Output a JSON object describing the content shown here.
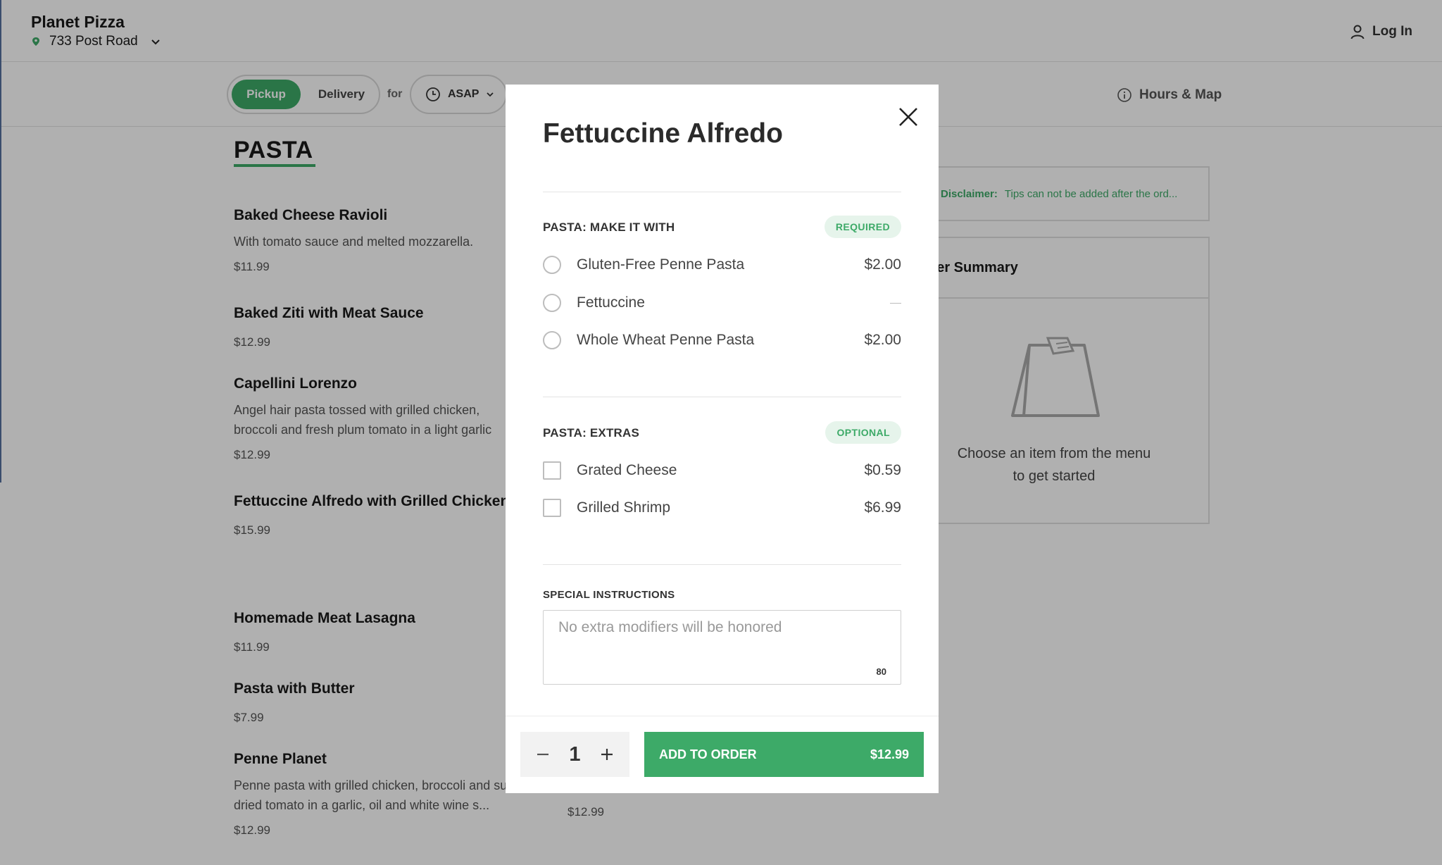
{
  "header": {
    "restaurant_name": "Planet Pizza",
    "location": "733 Post Road",
    "login_label": "Log In"
  },
  "order_bar": {
    "pickup_label": "Pickup",
    "delivery_label": "Delivery",
    "for_label": "for",
    "time_label": "ASAP",
    "hours_map_label": "Hours & Map"
  },
  "menu": {
    "section_title": "PASTA",
    "items": [
      {
        "name": "Baked Cheese Ravioli",
        "desc": "With tomato sauce and melted mozzarella.",
        "price": "$11.99"
      },
      {
        "name": "Baked Ziti with Meat Sauce",
        "desc": "",
        "price": "$12.99"
      },
      {
        "name": "Capellini Lorenzo",
        "desc": "Angel hair pasta tossed with grilled chicken, broccoli and fresh plum tomato in a light garlic",
        "price": "$12.99"
      },
      {
        "name": "Fettuccine Alfredo with Grilled Chicken",
        "desc": "",
        "price": "$15.99"
      },
      {
        "name": "Homemade Meat Lasagna",
        "desc": "",
        "price": "$11.99"
      },
      {
        "name": "Pasta with Butter",
        "desc": "",
        "price": "$7.99"
      },
      {
        "name": "Penne Planet",
        "desc": "Penne pasta with grilled chicken, broccoli and sun-dried tomato in a garlic, oil and white wine s...",
        "price": "$12.99"
      }
    ],
    "right_column_price": "$12.99"
  },
  "sidebar": {
    "disclaimer_label": "Disclaimer:",
    "disclaimer_text": "Tips can not be added after the ord...",
    "summary_title": "der Summary",
    "empty_line_1": "Choose an item from the menu",
    "empty_line_2": "to get started"
  },
  "modal": {
    "title": "Fettuccine Alfredo",
    "groups": [
      {
        "title": "PASTA: MAKE IT WITH",
        "badge": "REQUIRED",
        "options": [
          {
            "label": "Gluten-Free Penne Pasta",
            "price": "$2.00"
          },
          {
            "label": "Fettuccine",
            "price": ""
          },
          {
            "label": "Whole Wheat Penne Pasta",
            "price": "$2.00"
          }
        ]
      },
      {
        "title": "PASTA: EXTRAS",
        "badge": "OPTIONAL",
        "options": [
          {
            "label": "Grated Cheese",
            "price": "$0.59"
          },
          {
            "label": "Grilled Shrimp",
            "price": "$6.99"
          }
        ]
      }
    ],
    "special_instructions": {
      "title": "SPECIAL INSTRUCTIONS",
      "placeholder": "No extra modifiers will be honored",
      "char_count": "80"
    },
    "quantity": "1",
    "add_label": "ADD TO ORDER",
    "add_price": "$12.99"
  },
  "colors": {
    "accent": "#3daa68",
    "overlay": "rgba(0,0,0,0.31)"
  }
}
